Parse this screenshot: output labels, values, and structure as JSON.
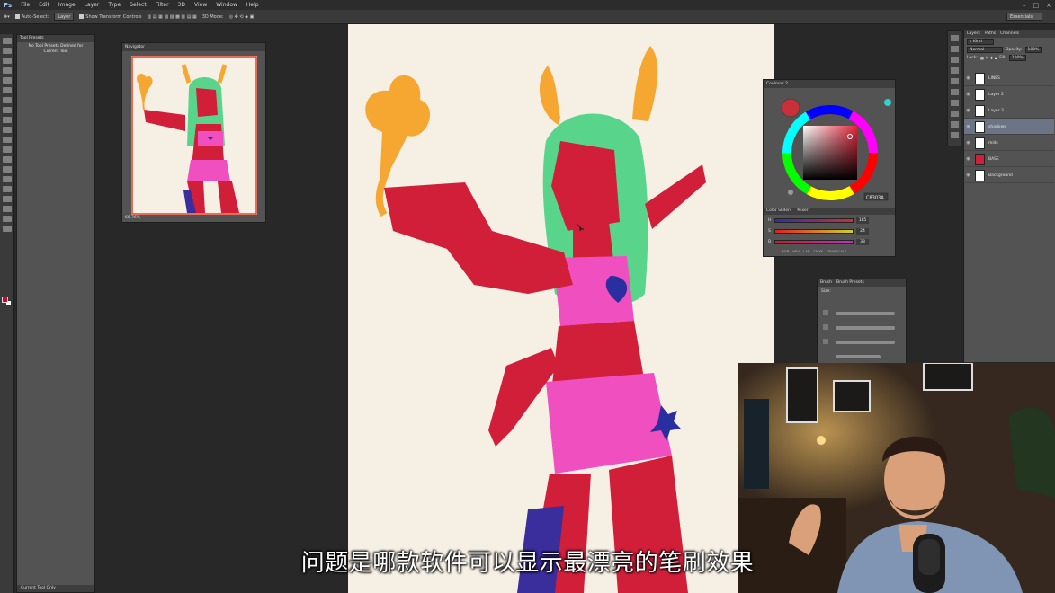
{
  "app": {
    "logo": "Ps"
  },
  "menu": [
    "File",
    "Edit",
    "Image",
    "Layer",
    "Type",
    "Select",
    "Filter",
    "3D",
    "View",
    "Window",
    "Help"
  ],
  "options_bar": {
    "auto_select_label": "Auto-Select:",
    "auto_select_value": "Layer",
    "show_transform_label": "Show Transform Controls",
    "mode_3d_label": "3D Mode:",
    "workspace": "Essentials"
  },
  "tool_presets": {
    "tab": "Tool Presets",
    "message": "No Tool Presets Defined for Current Tool",
    "footer": "Current Tool Only"
  },
  "navigator": {
    "tab": "Navigator",
    "zoom": "66.76%"
  },
  "color_panel": {
    "tab": "Coolorus 2",
    "hex": "C8303A",
    "sliders_tabs": [
      "Color Sliders",
      "Mixer"
    ],
    "sliders": [
      {
        "label": "H",
        "value": "185"
      },
      {
        "label": "S",
        "value": "24"
      },
      {
        "label": "B",
        "value": "38"
      }
    ],
    "modes": [
      "RGB",
      "HSV",
      "LAB",
      "CMYK",
      "GRAYSCALE"
    ],
    "accent": "#c8303a"
  },
  "brush_panel": {
    "tabs": [
      "Brush",
      "Brush Presets"
    ],
    "size_label": "Size:"
  },
  "layers_panel": {
    "tabs": [
      "Layers",
      "Paths",
      "Channels"
    ],
    "blend_mode": "Normal",
    "opacity_label": "Opacity:",
    "opacity_value": "100%",
    "lock_label": "Lock:",
    "fill_label": "Fill:",
    "fill_value": "100%",
    "layers": [
      {
        "name": "LINES",
        "selected": false
      },
      {
        "name": "Layer 2",
        "selected": false
      },
      {
        "name": "Layer 3",
        "selected": false
      },
      {
        "name": "shadows",
        "selected": true
      },
      {
        "name": "mids",
        "selected": false
      },
      {
        "name": "BASE",
        "selected": false
      },
      {
        "name": "Background",
        "selected": false
      }
    ]
  },
  "subtitle": "问题是哪款软件可以显示最漂亮的笔刷效果"
}
